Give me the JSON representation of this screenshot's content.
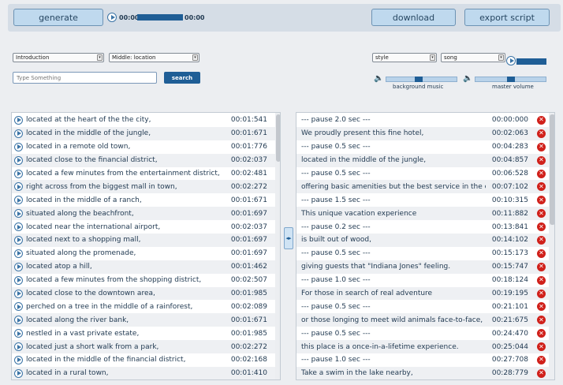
{
  "toolbar": {
    "generate_label": "generate",
    "download_label": "download",
    "export_label": "export script",
    "time_start": "00:00",
    "time_end": "00:00"
  },
  "selectors": {
    "intro": "Introduction",
    "middle": "Middle: location",
    "style": "style",
    "song": "song"
  },
  "search": {
    "placeholder": "Type Something",
    "button_label": "search"
  },
  "volume": {
    "background_label": "background music",
    "master_label": "master volume",
    "background_level": 0.4,
    "master_level": 0.5
  },
  "phrases": [
    {
      "text": "located at the heart of the the city,",
      "time": "00:01:541"
    },
    {
      "text": "located in the middle of the jungle,",
      "time": "00:01:671"
    },
    {
      "text": "located in a remote old town,",
      "time": "00:01:776"
    },
    {
      "text": "located close to the financial district,",
      "time": "00:02:037"
    },
    {
      "text": "located a few minutes from the entertainment district,",
      "time": "00:02:481"
    },
    {
      "text": "right across from the biggest mall in town,",
      "time": "00:02:272"
    },
    {
      "text": "located in the middle of a ranch,",
      "time": "00:01:671"
    },
    {
      "text": "situated along the beachfront,",
      "time": "00:01:697"
    },
    {
      "text": "located near the international airport,",
      "time": "00:02:037"
    },
    {
      "text": "located next to a shopping mall,",
      "time": "00:01:697"
    },
    {
      "text": "situated along the promenade,",
      "time": "00:01:697"
    },
    {
      "text": "located atop a hill,",
      "time": "00:01:462"
    },
    {
      "text": "located a few minutes from the shopping district,",
      "time": "00:02:507"
    },
    {
      "text": "located close to the downtown area,",
      "time": "00:01:985"
    },
    {
      "text": "perched on a tree in the middle of a rainforest,",
      "time": "00:02:089"
    },
    {
      "text": "located along the river bank,",
      "time": "00:01:671"
    },
    {
      "text": "nestled in a vast private estate,",
      "time": "00:01:985"
    },
    {
      "text": "located just a short walk from a park,",
      "time": "00:02:272"
    },
    {
      "text": "located in the middle of the financial district,",
      "time": "00:02:168"
    },
    {
      "text": "located in a rural town,",
      "time": "00:01:410"
    }
  ],
  "script": [
    {
      "text": "--- pause 2.0 sec ---",
      "time": "00:00:000"
    },
    {
      "text": "We proudly present this fine hotel,",
      "time": "00:02:063"
    },
    {
      "text": "--- pause 0.5 sec ---",
      "time": "00:04:283"
    },
    {
      "text": "located in the middle of the jungle,",
      "time": "00:04:857"
    },
    {
      "text": "--- pause 0.5 sec ---",
      "time": "00:06:528"
    },
    {
      "text": "offering basic amenities but the best service in the count",
      "time": "00:07:102"
    },
    {
      "text": "--- pause 1.5 sec ---",
      "time": "00:10:315"
    },
    {
      "text": "This unique vacation experience",
      "time": "00:11:882"
    },
    {
      "text": "--- pause 0.2 sec ---",
      "time": "00:13:841"
    },
    {
      "text": "is built out of wood,",
      "time": "00:14:102"
    },
    {
      "text": "--- pause 0.5 sec ---",
      "time": "00:15:173"
    },
    {
      "text": "giving guests that \"Indiana Jones\" feeling.",
      "time": "00:15:747"
    },
    {
      "text": "--- pause 1.0 sec ---",
      "time": "00:18:124"
    },
    {
      "text": "For those in search of real adventure",
      "time": "00:19:195"
    },
    {
      "text": "--- pause 0.5 sec ---",
      "time": "00:21:101"
    },
    {
      "text": "or those longing to meet wild animals face-to-face,",
      "time": "00:21:675"
    },
    {
      "text": "--- pause 0.5 sec ---",
      "time": "00:24:470"
    },
    {
      "text": "this place is a once-in-a-lifetime experience.",
      "time": "00:25:044"
    },
    {
      "text": "--- pause 1.0 sec ---",
      "time": "00:27:708"
    },
    {
      "text": "Take a swim in the lake nearby,",
      "time": "00:28:779"
    }
  ]
}
